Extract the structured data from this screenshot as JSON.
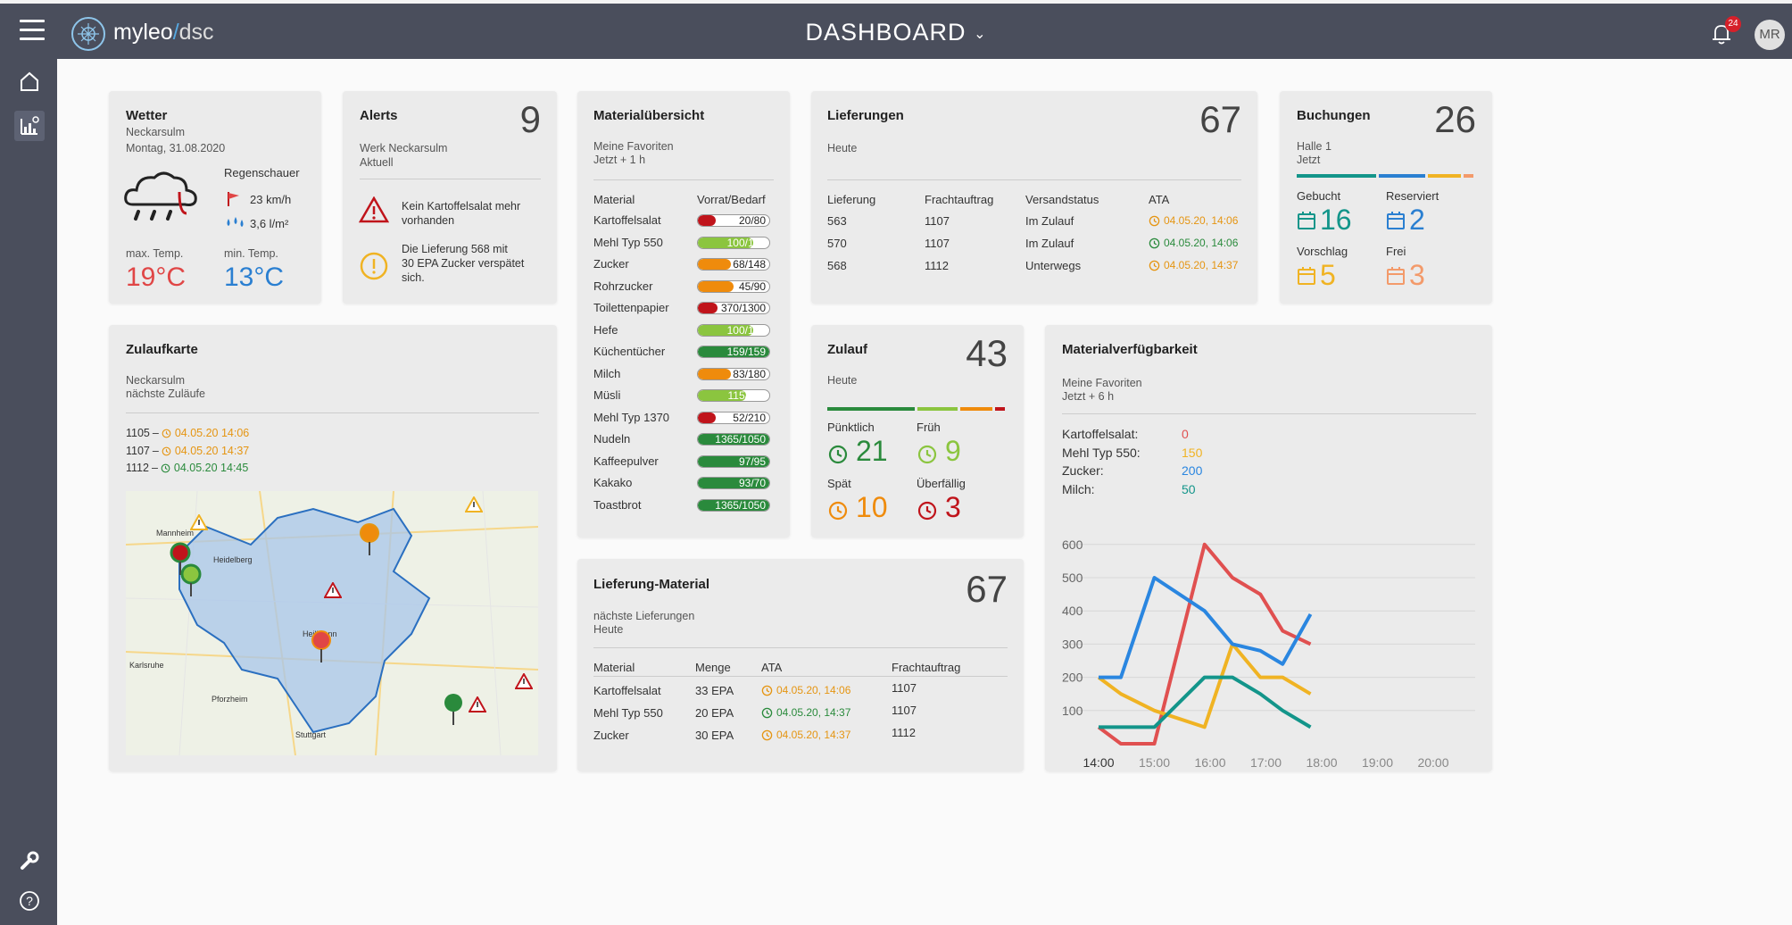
{
  "app": {
    "brand_name": "myleo",
    "brand_slash": "/",
    "brand_suffix": "dsc",
    "page_title": "DASHBOARD",
    "notification_count": "24",
    "user_initials": "MR"
  },
  "weather": {
    "title": "Wetter",
    "location": "Neckarsulm",
    "date": "Montag, 31.08.2020",
    "condition": "Regenschauer",
    "wind": "23 km/h",
    "rain": "3,6 l/m²",
    "max_label": "max. Temp.",
    "max_value": "19°C",
    "min_label": "min. Temp.",
    "min_value": "13°C"
  },
  "alerts": {
    "title": "Alerts",
    "count": "9",
    "line1": "Werk Neckarsulm",
    "line2": "Aktuell",
    "items": [
      {
        "icon": "warning-triangle-icon",
        "text1": "Kein Kartoffelsalat mehr",
        "text2": "vorhanden"
      },
      {
        "icon": "warning-circle-icon",
        "text1": "Die Lieferung 568 mit",
        "text2": "30 EPA Zucker verspätet",
        "text3": "sich."
      }
    ]
  },
  "material": {
    "title": "Materialübersicht",
    "line1": "Meine Favoriten",
    "line2": "Jetzt + 1 h",
    "col1": "Material",
    "col2": "Vorrat/Bedarf",
    "rows": [
      {
        "name": "Kartoffelsalat",
        "value": "20/80",
        "fill": 0.25,
        "color": "#c0141b"
      },
      {
        "name": "Mehl Typ 550",
        "value": "100/130",
        "fill": 0.77,
        "color": "#8bc53f"
      },
      {
        "name": "Zucker",
        "value": "68/148",
        "fill": 0.46,
        "color": "#ef8b0c"
      },
      {
        "name": "Rohrzucker",
        "value": "45/90",
        "fill": 0.5,
        "color": "#ef8b0c"
      },
      {
        "name": "Toilettenpapier",
        "value": "370/1300",
        "fill": 0.28,
        "color": "#c0141b"
      },
      {
        "name": "Hefe",
        "value": "100/130",
        "fill": 0.77,
        "color": "#8bc53f"
      },
      {
        "name": "Küchentücher",
        "value": "159/159",
        "fill": 1.0,
        "color": "#2a8a3c"
      },
      {
        "name": "Milch",
        "value": "83/180",
        "fill": 0.46,
        "color": "#ef8b0c"
      },
      {
        "name": "Müsli",
        "value": "115/170",
        "fill": 0.68,
        "color": "#8bc53f"
      },
      {
        "name": "Mehl Typ 1370",
        "value": "52/210",
        "fill": 0.25,
        "color": "#c0141b"
      },
      {
        "name": "Nudeln",
        "value": "1365/1050",
        "fill": 1.0,
        "color": "#2a8a3c"
      },
      {
        "name": "Kaffeepulver",
        "value": "97/95",
        "fill": 1.0,
        "color": "#2a8a3c"
      },
      {
        "name": "Kakako",
        "value": "93/70",
        "fill": 1.0,
        "color": "#2a8a3c"
      },
      {
        "name": "Toastbrot",
        "value": "1365/1050",
        "fill": 1.0,
        "color": "#2a8a3c"
      }
    ]
  },
  "deliveries": {
    "title": "Lieferungen",
    "count": "67",
    "line1": "Heute",
    "headers": [
      "Lieferung",
      "Frachtauftrag",
      "Versandstatus",
      "ATA"
    ],
    "rows": [
      {
        "id": "563",
        "order": "1107",
        "status": "Im Zulauf",
        "ata": "04.05.20, 14:06",
        "color": "#e59512"
      },
      {
        "id": "570",
        "order": "1107",
        "status": "Im Zulauf",
        "ata": "04.05.20, 14:06",
        "color": "#2a8a3c"
      },
      {
        "id": "568",
        "order": "1112",
        "status": "Unterwegs",
        "ata": "04.05.20, 14:37",
        "color": "#e59512"
      }
    ]
  },
  "bookings": {
    "title": "Buchungen",
    "count": "26",
    "line1": "Halle 1",
    "line2": "Jetzt",
    "segments": [
      {
        "fraction": 0.46,
        "color": "#13958a"
      },
      {
        "fraction": 0.27,
        "color": "#2a7fd1"
      },
      {
        "fraction": 0.2,
        "color": "#f0b323"
      },
      {
        "fraction": 0.07,
        "color": "#f39a6a"
      }
    ],
    "items": [
      {
        "label": "Gebucht",
        "value": "16",
        "color": "#13958a"
      },
      {
        "label": "Reserviert",
        "value": "2",
        "color": "#2a7fd1"
      },
      {
        "label": "Vorschlag",
        "value": "5",
        "color": "#f0b323"
      },
      {
        "label": "Frei",
        "value": "3",
        "color": "#f39a6a"
      }
    ]
  },
  "zulaufkarte": {
    "title": "Zulaufkarte",
    "line1": "Neckarsulm",
    "line2": "nächste Zuläufe",
    "entries": [
      {
        "id": "1105",
        "sep": "–",
        "time": "04.05.20 14:06",
        "color": "#e59512"
      },
      {
        "id": "1107",
        "sep": "–",
        "time": "04.05.20 14:37",
        "color": "#e59512"
      },
      {
        "id": "1112",
        "sep": "–",
        "time": "04.05.20 14:45",
        "color": "#2a8a3c"
      }
    ],
    "map_labels": {
      "city1": "Mannheim",
      "city2": "Heidelberg",
      "city3": "Heilbronn",
      "city4": "Stuttgart",
      "city5": "Karlsruhe",
      "city6": "Pforzheim"
    }
  },
  "zulauf": {
    "title": "Zulauf",
    "count": "43",
    "line1": "Heute",
    "segments": [
      {
        "fraction": 0.5,
        "color": "#2a8a3c"
      },
      {
        "fraction": 0.24,
        "color": "#8bc53f"
      },
      {
        "fraction": 0.19,
        "color": "#ef8b0c"
      },
      {
        "fraction": 0.07,
        "color": "#c0141b"
      }
    ],
    "items": [
      {
        "label": "Pünktlich",
        "value": "21",
        "color": "#2a8a3c"
      },
      {
        "label": "Früh",
        "value": "9",
        "color": "#8bc53f"
      },
      {
        "label": "Spät",
        "value": "10",
        "color": "#ef8b0c"
      },
      {
        "label": "Überfällig",
        "value": "3",
        "color": "#c0141b"
      }
    ]
  },
  "liefer_material": {
    "title": "Lieferung-Material",
    "count": "67",
    "line1": "nächste Lieferungen",
    "line2": "Heute",
    "headers": [
      "Material",
      "Menge",
      "ATA",
      "Frachtauftrag"
    ],
    "rows": [
      {
        "material": "Kartoffelsalat",
        "qty": "33 EPA",
        "ata": "04.05.20, 14:06",
        "order": "1107",
        "color": "#e59512"
      },
      {
        "material": "Mehl Typ 550",
        "qty": "20 EPA",
        "ata": "04.05.20, 14:37",
        "order": "1107",
        "color": "#2a8a3c"
      },
      {
        "material": "Zucker",
        "qty": "30 EPA",
        "ata": "04.05.20, 14:37",
        "order": "1112",
        "color": "#e59512"
      }
    ]
  },
  "availability": {
    "title": "Materialverfügbarkeit",
    "line1": "Meine Favoriten",
    "line2": "Jetzt + 6 h",
    "legend": [
      {
        "name": "Kartoffelsalat:",
        "value": "0",
        "color": "#e05050"
      },
      {
        "name": "Mehl Typ 550:",
        "value": "150",
        "color": "#f0b323"
      },
      {
        "name": "Zucker:",
        "value": "200",
        "color": "#2a86e0"
      },
      {
        "name": "Milch:",
        "value": "50",
        "color": "#13958a"
      }
    ]
  },
  "chart_data": {
    "type": "line",
    "x": [
      "14:00",
      "15:00",
      "16:00",
      "17:00",
      "18:00",
      "19:00",
      "20:00"
    ],
    "yticks": [
      100,
      200,
      300,
      400,
      500,
      600
    ],
    "ylim": [
      0,
      620
    ],
    "series": [
      {
        "name": "Kartoffelsalat",
        "color": "#e05050",
        "points": [
          [
            0,
            50
          ],
          [
            0.4,
            0
          ],
          [
            1,
            0
          ],
          [
            1.9,
            600
          ],
          [
            2.4,
            500
          ],
          [
            2.9,
            450
          ],
          [
            3.3,
            340
          ],
          [
            3.8,
            300
          ]
        ]
      },
      {
        "name": "Mehl Typ 550",
        "color": "#f0b323",
        "points": [
          [
            0,
            200
          ],
          [
            0.4,
            150
          ],
          [
            1,
            100
          ],
          [
            1.9,
            50
          ],
          [
            2.4,
            300
          ],
          [
            2.9,
            200
          ],
          [
            3.3,
            200
          ],
          [
            3.8,
            150
          ]
        ]
      },
      {
        "name": "Zucker",
        "color": "#2a86e0",
        "points": [
          [
            0,
            200
          ],
          [
            0.4,
            200
          ],
          [
            1,
            500
          ],
          [
            1.9,
            400
          ],
          [
            2.4,
            300
          ],
          [
            2.9,
            280
          ],
          [
            3.3,
            240
          ],
          [
            3.8,
            390
          ]
        ]
      },
      {
        "name": "Milch",
        "color": "#13958a",
        "points": [
          [
            0,
            50
          ],
          [
            0.4,
            50
          ],
          [
            1,
            50
          ],
          [
            1.9,
            200
          ],
          [
            2.4,
            200
          ],
          [
            2.9,
            150
          ],
          [
            3.3,
            100
          ],
          [
            3.8,
            50
          ]
        ]
      }
    ]
  }
}
